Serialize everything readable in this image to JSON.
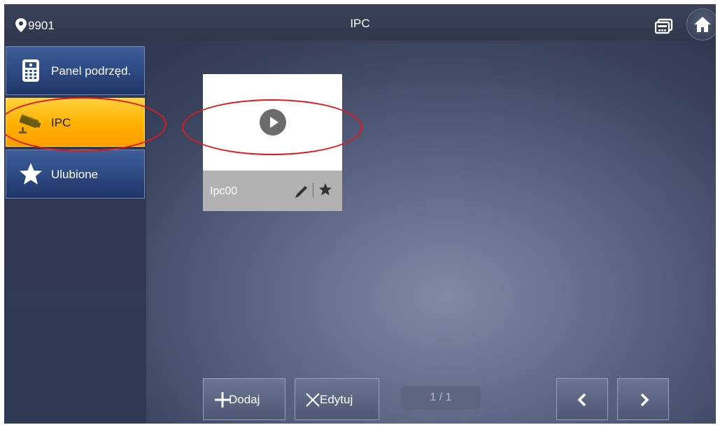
{
  "header": {
    "location_id": "9901",
    "title": "IPC"
  },
  "sidebar": {
    "items": [
      {
        "label": "Panel podrzęd.",
        "icon": "panel-icon",
        "active": false
      },
      {
        "label": "IPC",
        "icon": "camera-icon",
        "active": true
      },
      {
        "label": "Ulubione",
        "icon": "star-icon",
        "active": false
      }
    ]
  },
  "devices": [
    {
      "name": "Ipc00",
      "favorite": true
    }
  ],
  "toolbar": {
    "add_label": "Dodaj",
    "edit_label": "Edytuj",
    "page_indicator": "1 / 1"
  },
  "colors": {
    "active_tab": "#ffb000",
    "annotation": "#e0181c"
  }
}
